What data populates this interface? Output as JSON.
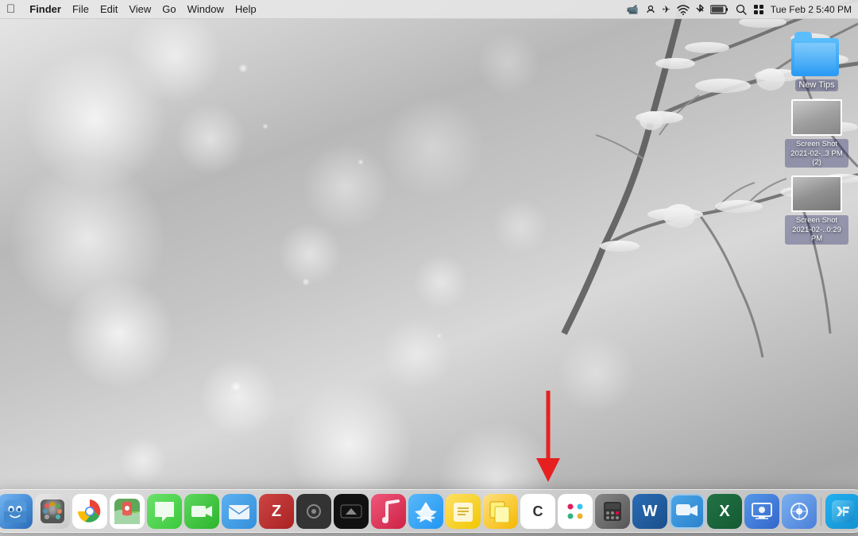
{
  "menubar": {
    "apple": "⌘",
    "finder": "Finder",
    "file": "File",
    "edit": "Edit",
    "view": "View",
    "go": "Go",
    "window": "Window",
    "help": "Help",
    "datetime": "Tue Feb 2  5:40 PM",
    "battery": "🔋",
    "wifi": "WiFi",
    "bluetooth": "BT",
    "search": "🔍"
  },
  "desktop_icons": [
    {
      "id": "new-tips-folder",
      "label": "New Tips",
      "type": "folder"
    },
    {
      "id": "screenshot-1",
      "label": "Screen Shot 2021-02-..3 PM (2)",
      "type": "screenshot"
    },
    {
      "id": "screenshot-2",
      "label": "Screen Shot 2021-02-...0:29 PM",
      "type": "screenshot"
    }
  ],
  "dock": {
    "items": [
      {
        "id": "finder",
        "label": "Finder",
        "class": "dock-finder"
      },
      {
        "id": "launchpad",
        "label": "Launchpad",
        "class": "dock-launchpad"
      },
      {
        "id": "chrome",
        "label": "Chrome",
        "class": "dock-chrome"
      },
      {
        "id": "maps",
        "label": "Maps",
        "class": "dock-maps"
      },
      {
        "id": "messages",
        "label": "Messages",
        "class": "dock-messages"
      },
      {
        "id": "facetime",
        "label": "FaceTime",
        "class": "dock-facetime"
      },
      {
        "id": "mail",
        "label": "Mail",
        "class": "dock-mail"
      },
      {
        "id": "zotero",
        "label": "Zotero",
        "class": "dock-zotero"
      },
      {
        "id": "multitouch",
        "label": "Multitouch",
        "class": "dock-multitouch"
      },
      {
        "id": "appletv",
        "label": "Apple TV",
        "class": "dock-appletv"
      },
      {
        "id": "music",
        "label": "Music",
        "class": "dock-music"
      },
      {
        "id": "appstore",
        "label": "App Store",
        "class": "dock-appstore"
      },
      {
        "id": "notes",
        "label": "Notes",
        "class": "dock-notes"
      },
      {
        "id": "stickies",
        "label": "Stickies",
        "class": "dock-stickies"
      },
      {
        "id": "craftdocs",
        "label": "Craft",
        "class": "dock-craftdocs"
      },
      {
        "id": "slack",
        "label": "Slack",
        "class": "dock-slack"
      },
      {
        "id": "calculator",
        "label": "Calculator",
        "class": "dock-calculator"
      },
      {
        "id": "word",
        "label": "Word",
        "class": "dock-word"
      },
      {
        "id": "zoom",
        "label": "Zoom",
        "class": "dock-zoom"
      },
      {
        "id": "excel",
        "label": "Excel",
        "class": "dock-excel"
      },
      {
        "id": "screenium",
        "label": "Screenium",
        "class": "dock-screenium"
      },
      {
        "id": "proxyman",
        "label": "Proxyman",
        "class": "dock-proxyman"
      },
      {
        "id": "xcode",
        "label": "Xcode",
        "class": "dock-xcode"
      }
    ]
  }
}
